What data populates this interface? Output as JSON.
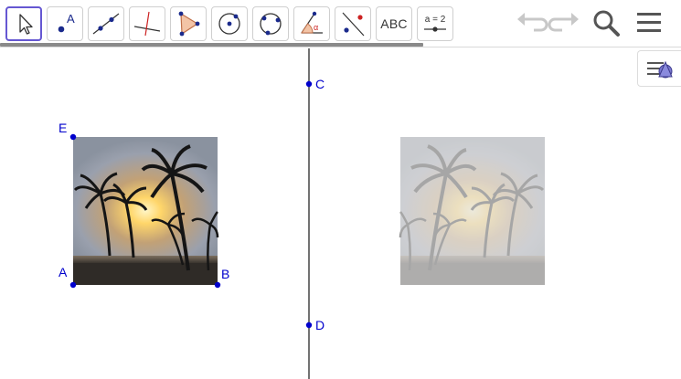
{
  "toolbar": {
    "tools": [
      {
        "name": "move-tool",
        "icon": "arrow-cursor-icon"
      },
      {
        "name": "point-tool",
        "icon": "point-icon",
        "label": "A"
      },
      {
        "name": "line-tool",
        "icon": "line-icon"
      },
      {
        "name": "perpendicular-line-tool",
        "icon": "perpendicular-icon"
      },
      {
        "name": "polygon-tool",
        "icon": "triangle-icon"
      },
      {
        "name": "circle-tool",
        "icon": "circle-center-icon"
      },
      {
        "name": "circle-three-points-tool",
        "icon": "circle-three-points-icon"
      },
      {
        "name": "angle-tool",
        "icon": "angle-icon",
        "label": "α"
      },
      {
        "name": "reflect-tool",
        "icon": "reflect-line-icon"
      },
      {
        "name": "text-tool",
        "icon": "text-icon",
        "label": "ABC"
      },
      {
        "name": "slider-tool",
        "icon": "slider-icon",
        "label": "a = 2"
      }
    ]
  },
  "points": {
    "A": "A",
    "B": "B",
    "C": "C",
    "D": "D",
    "E": "E"
  },
  "colors": {
    "accent": "#6557d2",
    "point": "#0000cc",
    "line": "#444444"
  }
}
